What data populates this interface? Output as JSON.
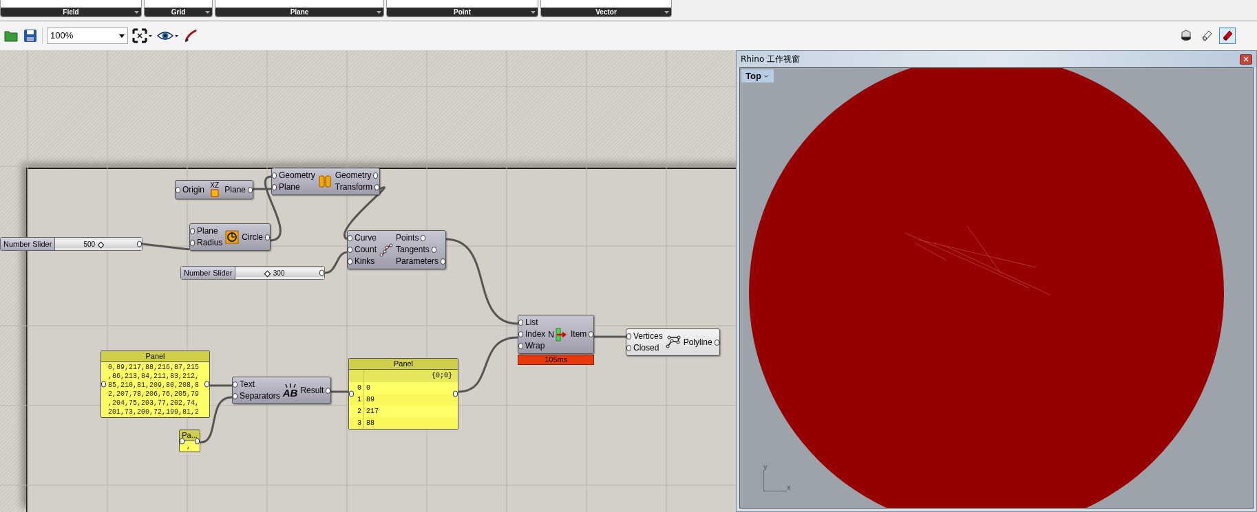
{
  "ribbon": {
    "groups": [
      {
        "label": "Field"
      },
      {
        "label": "Grid"
      },
      {
        "label": "Plane"
      },
      {
        "label": "Point"
      },
      {
        "label": "Vector"
      }
    ]
  },
  "toolbar": {
    "zoom": "100%",
    "preview_modes": [
      {
        "selected": false
      },
      {
        "selected": false
      },
      {
        "selected": true
      }
    ]
  },
  "canvas": {
    "objects": [
      {
        "kind": "component",
        "icon_text": "XZ",
        "inputs": [
          "Origin"
        ],
        "outputs": [
          "Plane"
        ],
        "preview": true
      },
      {
        "kind": "component",
        "inputs": [
          "Geometry",
          "Plane"
        ],
        "outputs": [
          "Geometry",
          "Transform"
        ],
        "preview": true
      },
      {
        "kind": "slider",
        "label": "Number Slider",
        "value": "500",
        "level": 0.5
      },
      {
        "kind": "component",
        "inputs": [
          "Plane",
          "Radius"
        ],
        "outputs": [
          "Circle"
        ],
        "preview": true
      },
      {
        "kind": "component",
        "inputs": [
          "Curve",
          "Count",
          "Kinks"
        ],
        "outputs": [
          "Points",
          "Tangents",
          "Parameters"
        ],
        "preview": true
      },
      {
        "kind": "slider",
        "label": "Number Slider",
        "value": "300",
        "level": 0.33
      },
      {
        "kind": "component",
        "icon_text": "N",
        "inputs": [
          "List",
          "Index",
          "Wrap"
        ],
        "outputs": [
          "Item"
        ],
        "timer": "105ms",
        "preview": true
      },
      {
        "kind": "component",
        "inputs": [
          "Vertices",
          "Closed"
        ],
        "outputs": [
          "Polyline"
        ],
        "preview": false
      },
      {
        "kind": "text-panel",
        "title": "Panel",
        "lines": [
          "0,89,217,88,216,87,215",
          ",86,213,84,211,83,212,",
          "85,210,81,209,80,208,8",
          "2,207,78,206,76,205,79",
          ",204,75,203,77,202,74,",
          "201,73,200,72,199,81,2"
        ]
      },
      {
        "kind": "component",
        "icon_text": "AB",
        "inputs": [
          "Text",
          "Separators"
        ],
        "outputs": [
          "Result"
        ],
        "preview": true
      },
      {
        "kind": "list-panel",
        "title": "Panel",
        "path": "{0;0}",
        "rows": [
          {
            "index": "0",
            "value": "0"
          },
          {
            "index": "1",
            "value": "89"
          },
          {
            "index": "2",
            "value": "217"
          },
          {
            "index": "3",
            "value": "88"
          }
        ]
      },
      {
        "kind": "text-panel",
        "title": "Pa...",
        "lines": [
          ","
        ]
      }
    ]
  },
  "rhino_window": {
    "title": "Rhino 工作视窗",
    "viewport": "Top",
    "axis_x": "x",
    "axis_y": "y"
  }
}
